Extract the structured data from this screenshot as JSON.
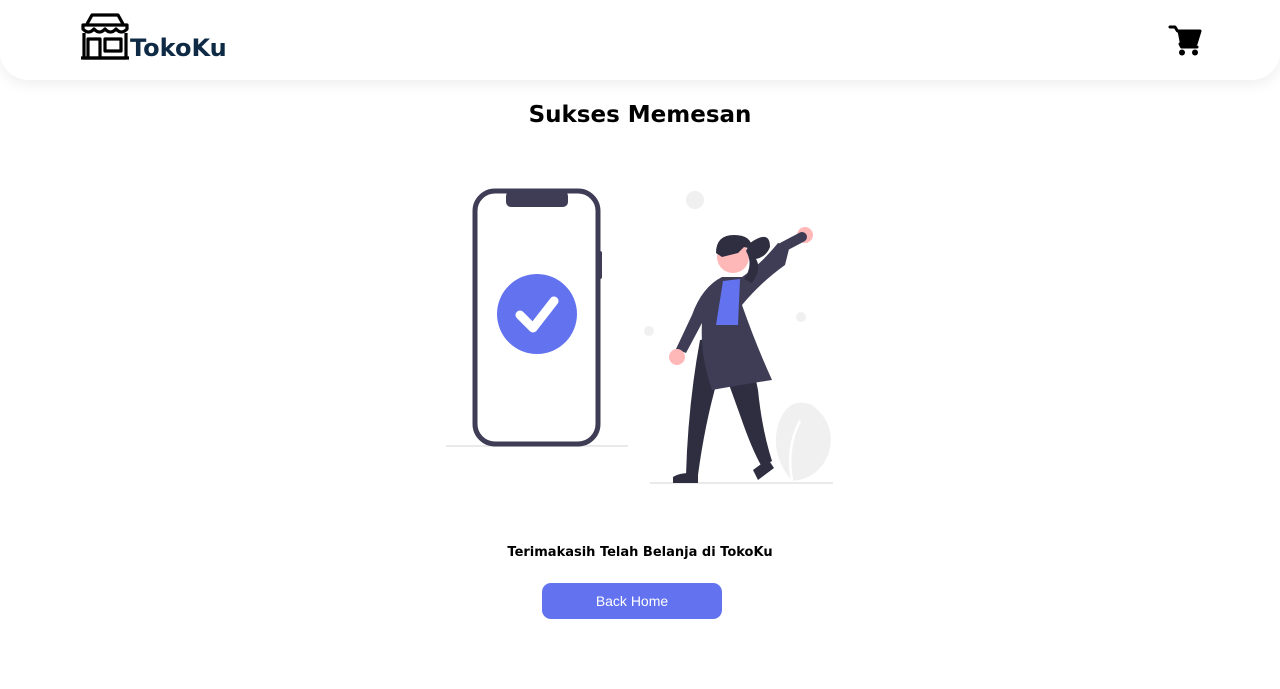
{
  "header": {
    "brand_name": "TokoKu",
    "brand_icon": "store-icon",
    "cart_icon": "shopping-cart-icon"
  },
  "main": {
    "title": "Sukses Memesan",
    "illustration": "order-success-illustration",
    "message": "Terimakasih Telah Belanja di TokoKu",
    "button_label": "Back Home"
  },
  "colors": {
    "accent": "#6373ef",
    "phone_frame": "#3f3d56",
    "brand_text": "#0f2a44"
  }
}
